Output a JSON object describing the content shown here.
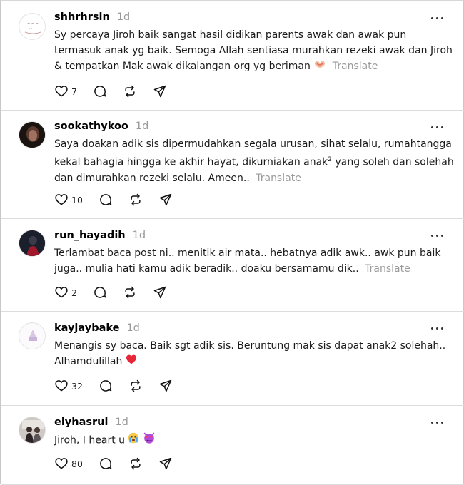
{
  "ui": {
    "more_icon": "more-horizontal-icon",
    "like_icon": "heart-outline-icon",
    "reply_icon": "comment-bubble-icon",
    "repost_icon": "repost-arrows-icon",
    "share_icon": "send-paper-plane-icon",
    "translate_label": "Translate"
  },
  "posts": [
    {
      "username": "shhrhrsln",
      "time": "1d",
      "text": "Sy percaya Jiroh baik sangat hasil didikan parents awak dan awak pun termasuk anak yg baik. Semoga Allah sentiasa murahkan rezeki awak dan Jiroh & tempatkan Mak awak dikalangan org yg beriman",
      "emoji": "heart-hands-emoji",
      "likes": "7"
    },
    {
      "username": "sookathykoo",
      "time": "1d",
      "text_a": "Saya doakan adik sis dipermudahkan segala urusan, sihat selalu, rumahtangga kekal bahagia hingga ke akhir hayat, dikurniakan anak",
      "text_sup": "2",
      "text_b": " yang soleh dan solehah dan dimurahkan rezeki selalu. Ameen..",
      "likes": "10"
    },
    {
      "username": "run_hayadih",
      "time": "1d",
      "text": "Terlambat baca post ni.. menitik air mata.. hebatnya adik awk.. awk pun baik juga.. mulia hati kamu adik beradik.. doaku bersamamu dik..",
      "likes": "2"
    },
    {
      "username": "kayjaybake",
      "time": "1d",
      "text": "Menangis sy baca. Baik sgt adik sis. Beruntung mak sis dapat anak2 solehah.. Alhamdulillah",
      "emoji": "red-heart-emoji",
      "likes": "32"
    },
    {
      "username": "elyhasrul",
      "time": "1d",
      "text": "Jiroh, I heart u",
      "emoji_1": "crying-face-emoji",
      "emoji_2": "heart-eyes-devil-emoji",
      "likes": "80"
    }
  ]
}
